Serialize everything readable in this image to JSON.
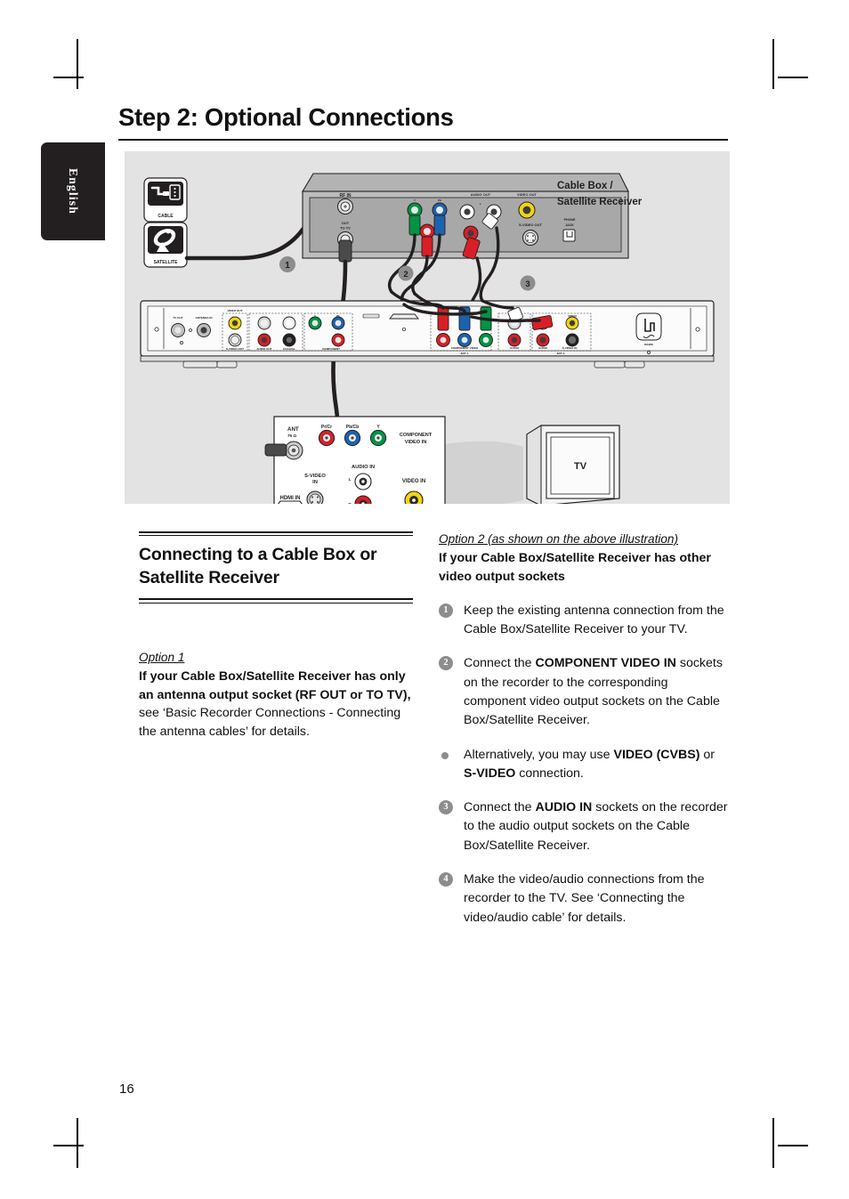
{
  "page": {
    "title": "Step 2: Optional Connections",
    "language_tab": "English",
    "page_number": "16"
  },
  "illustration": {
    "source_icons": {
      "cable": "CABLE",
      "satellite": "SATELLITE"
    },
    "device_caption_line1": "Cable Box /",
    "device_caption_line2": "Satellite Receiver",
    "cable_box_ports": {
      "rf_in": "RF IN",
      "out_to_tv_line1": "OUT",
      "out_to_tv_line2": "TO TV",
      "component_y": "Y",
      "component_pb": "Pb",
      "audio_out": "AUDIO OUT",
      "audio_left": "L",
      "audio_right": "R",
      "video_out": "VIDEO OUT",
      "s_video_out": "S-VIDEO OUT",
      "phone_jack_line1": "PHONE",
      "phone_jack_line2": "JACK"
    },
    "recorder_ports": {
      "tv_out": "TV OUT",
      "antenna_in": "ANTENNA IN",
      "video_out": "VIDEO OUT",
      "s_video_out": "S-VIDEO OUT",
      "audio_out": "AUDIO OUT",
      "coaxial_digital_out": "COAXIAL DIGITAL OUT",
      "component_video_out": "COMPONENT VIDEO OUT",
      "component_video_in": "COMPONENT VIDEO",
      "ext1": "EXT 1",
      "audio1": "AUDIO",
      "audio2": "AUDIO",
      "s_video_in": "S-VIDEO IN",
      "ext2": "EXT 2",
      "mains": "MAINS"
    },
    "tv_panel_ports": {
      "ant": "ANT",
      "ant_ohm": "75 Ω",
      "pr_cr": "Pr/Cr",
      "pb_cb": "Pb/Cb",
      "y": "Y",
      "component_video_in_line1": "COMPONENT",
      "component_video_in_line2": "VIDEO IN",
      "hdmi_in": "HDMI IN",
      "s_video_in_line1": "S-VIDEO",
      "s_video_in_line2": "IN",
      "audio_in": "AUDIO IN",
      "audio_left": "L",
      "audio_right": "R",
      "video_in": "VIDEO IN",
      "tv_label": "TV"
    },
    "callouts": [
      "1",
      "2",
      "3"
    ]
  },
  "left_column": {
    "section_heading": "Connecting to a Cable Box or Satellite Receiver",
    "option_label": "Option  1",
    "option_bold": "If your Cable Box/Satellite Receiver has only an antenna output socket (RF OUT or TO TV),",
    "option_body": "see ‘Basic Recorder Connections - Connecting the antenna cables’ for details."
  },
  "right_column": {
    "option_label": "Option 2 (as shown on the above illustration)",
    "option_bold": "If your Cable Box/Satellite Receiver has other video output sockets",
    "steps": [
      {
        "badge": "1",
        "type": "number",
        "text": "Keep the existing antenna connection from the Cable Box/Satellite Receiver to your TV."
      },
      {
        "badge": "2",
        "type": "number",
        "text": "Connect the COMPONENT VIDEO IN sockets on the recorder to the corresponding component video output sockets on the Cable Box/Satellite Receiver."
      },
      {
        "badge": "",
        "type": "bullet",
        "text": "Alternatively, you may use VIDEO (CVBS) or S-VIDEO connection."
      },
      {
        "badge": "3",
        "type": "number",
        "text": "Connect the AUDIO IN sockets on the recorder to the audio output sockets on the Cable Box/Satellite Receiver."
      },
      {
        "badge": "4",
        "type": "number",
        "text": "Make the video/audio connections from the recorder to the TV.  See ‘Connecting the video/audio cable’ for details."
      }
    ]
  },
  "colors": {
    "panel_background": "#e3e3e3",
    "badge_gray": "#8d8d8d",
    "tab_black": "#231f20",
    "connector_red": "#d81f26",
    "connector_blue": "#1b63ae",
    "connector_green": "#009444",
    "connector_yellow": "#f3d512",
    "connector_white": "#ffffff",
    "connector_black": "#231f20"
  }
}
